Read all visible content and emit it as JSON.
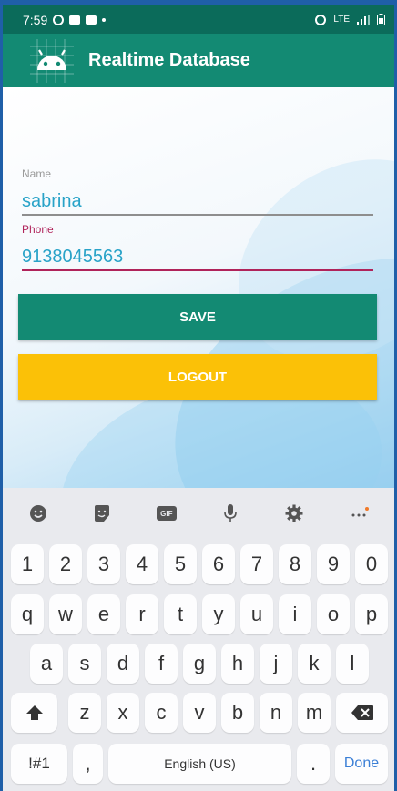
{
  "status_bar": {
    "time": "7:59",
    "network": "LTE"
  },
  "app_bar": {
    "title": "Realtime Database",
    "logo_icon": "android-icon"
  },
  "form": {
    "name_label": "Name",
    "name_value": "sabrina",
    "phone_label": "Phone",
    "phone_value": "9138045563",
    "save_label": "SAVE",
    "logout_label": "LOGOUT"
  },
  "colors": {
    "status_bar": "#0b6b5a",
    "app_bar": "#138a73",
    "save_button": "#138a73",
    "logout_button": "#fbc107",
    "field_text": "#29a3c8",
    "phone_accent": "#b0235a"
  },
  "keyboard": {
    "toolbar": [
      "emoji-icon",
      "sticker-icon",
      "gif-icon",
      "mic-icon",
      "settings-icon",
      "more-icon"
    ],
    "gif_label": "GIF",
    "rows": [
      [
        "1",
        "2",
        "3",
        "4",
        "5",
        "6",
        "7",
        "8",
        "9",
        "0"
      ],
      [
        "q",
        "w",
        "e",
        "r",
        "t",
        "y",
        "u",
        "i",
        "o",
        "p"
      ],
      [
        "a",
        "s",
        "d",
        "f",
        "g",
        "h",
        "j",
        "k",
        "l"
      ],
      [
        "z",
        "x",
        "c",
        "v",
        "b",
        "n",
        "m"
      ]
    ],
    "symbols_label": "!#1",
    "comma_label": ",",
    "space_label": "English (US)",
    "period_label": ".",
    "done_label": "Done"
  }
}
